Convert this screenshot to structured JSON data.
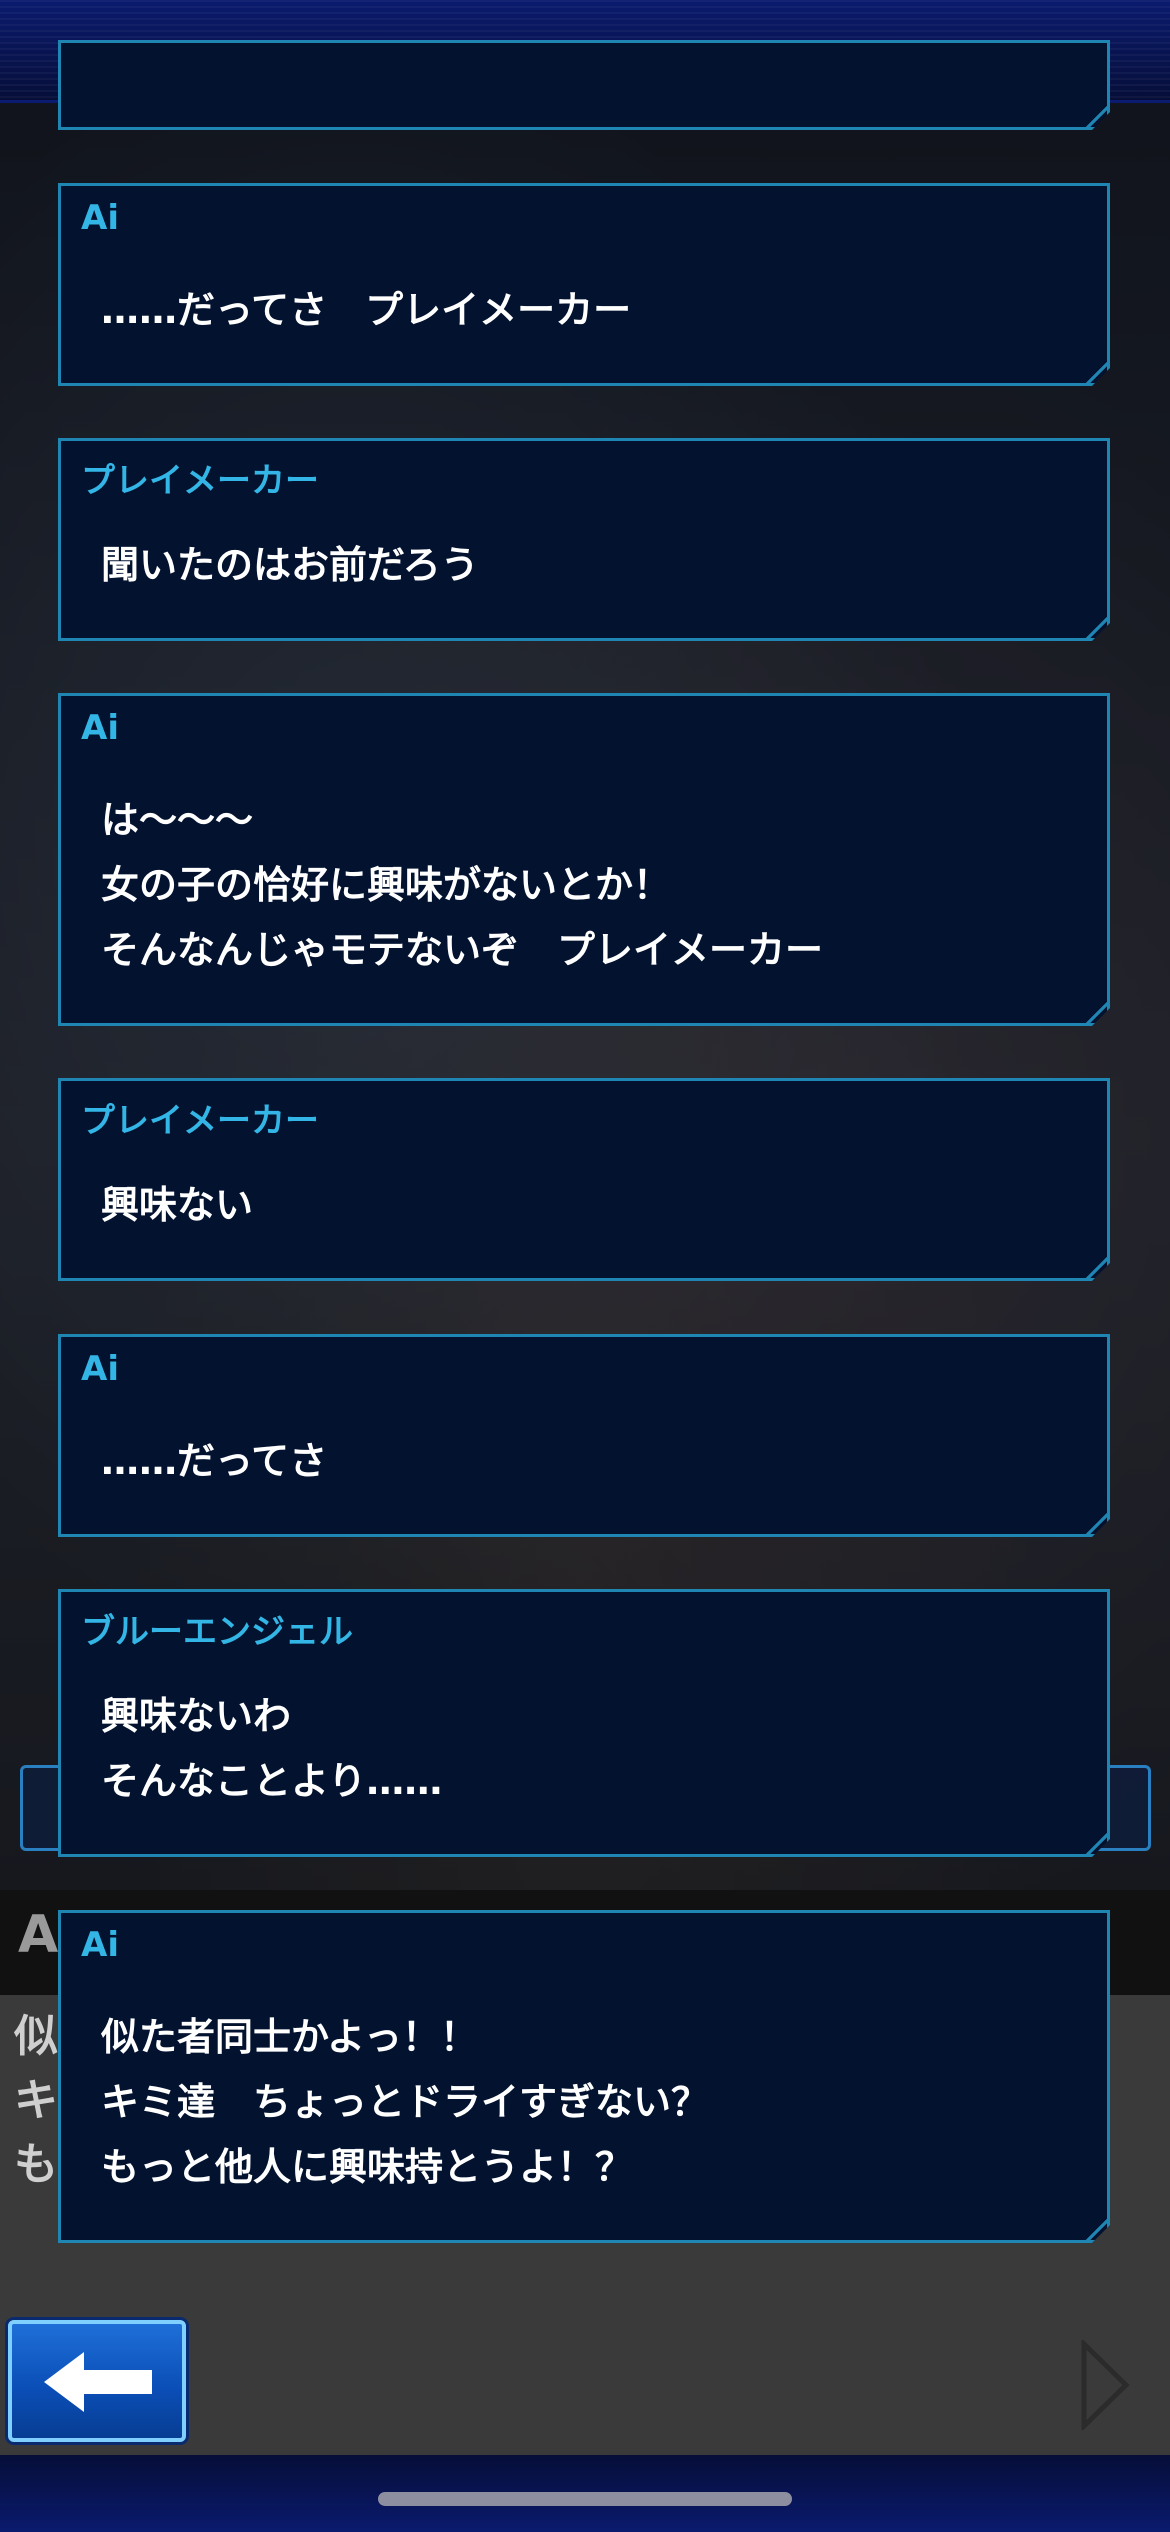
{
  "messages": [
    {
      "speaker": "Ai",
      "lines": [
        "……だってさ　プレイメーカー"
      ]
    },
    {
      "speaker": "プレイメーカー",
      "lines": [
        "聞いたのはお前だろう"
      ]
    },
    {
      "speaker": "Ai",
      "lines": [
        "は〜〜〜",
        "女の子の恰好に興味がないとか！",
        "そんなんじゃモテないぞ　プレイメーカー"
      ]
    },
    {
      "speaker": "プレイメーカー",
      "lines": [
        "興味ない"
      ]
    },
    {
      "speaker": "Ai",
      "lines": [
        "……だってさ"
      ]
    },
    {
      "speaker": "ブルーエンジェル",
      "lines": [
        "興味ないわ",
        "そんなことより……"
      ]
    },
    {
      "speaker": "Ai",
      "lines": [
        "似た者同士かよっ！！",
        "キミ達　ちょっとドライすぎない？",
        "もっと他人に興味持とうよ！？"
      ]
    }
  ],
  "background": {
    "partial_name_letter": "A",
    "partial_text": [
      "似",
      "キ",
      "も"
    ]
  },
  "controls": {
    "back_icon": "left-arrow-icon",
    "next_icon": "triangle-right-icon"
  },
  "colors": {
    "speaker": "#33b6e6",
    "box_fill": "#02122f",
    "box_border": "#1f86b4",
    "bar": "#0a1a6e"
  }
}
